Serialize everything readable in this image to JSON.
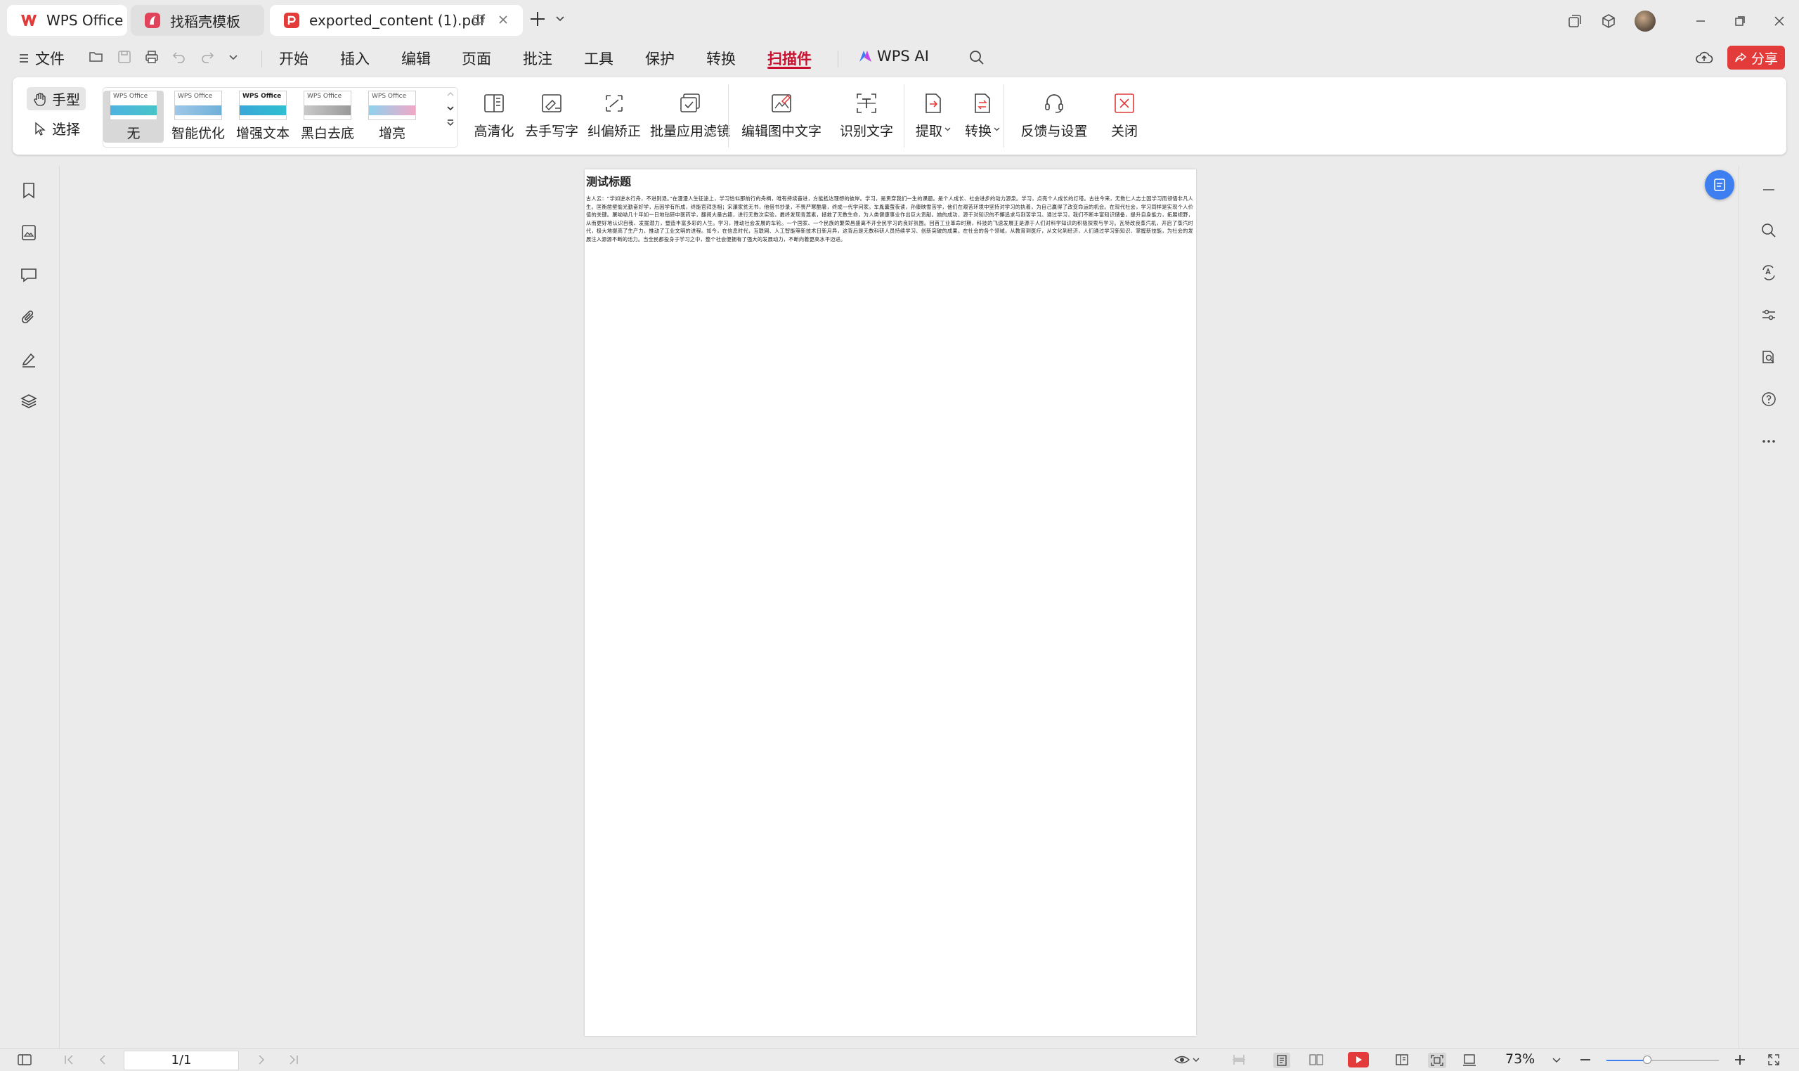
{
  "tabs": [
    {
      "label": "WPS Office",
      "icon": "wps-logo-icon"
    },
    {
      "label": "找稻壳模板",
      "icon": "docer-icon"
    },
    {
      "label": "exported_content (1).pdf",
      "icon": "pdf-icon"
    }
  ],
  "menu": {
    "file": "文件",
    "items": [
      "开始",
      "插入",
      "编辑",
      "页面",
      "批注",
      "工具",
      "保护",
      "转换",
      "扫描件"
    ],
    "active": "扫描件",
    "wps_ai": "WPS AI",
    "share": "分享"
  },
  "ribbon": {
    "hand": "手型",
    "select": "选择",
    "filter_thumb_text": "WPS Office",
    "filters": [
      "无",
      "智能优化",
      "增强文本",
      "黑白去底",
      "增亮"
    ],
    "tools": [
      "高清化",
      "去手写字",
      "纠偏矫正",
      "批量应用滤镜",
      "编辑图中文字",
      "识别文字",
      "提取",
      "转换",
      "反馈与设置",
      "关闭"
    ]
  },
  "document": {
    "title": "测试标题",
    "body": "古人云：“学如逆水行舟，不进则退。”在漫漫人生征途上，学习恰似那前行的舟楫，唯有持续奋进，方能抵达理想的彼岸。学习，是贯穿我们一生的课题。是个人成长、社会进步的动力源泉。学习，点亮个人成长的灯塔。古往今来，无数仁人志士因学习而领悟非凡人生。匡衡凿壁偷光勤奋好学，后因学有所成，终能官拜丞相；宋濂家贫无书，他借书抄录，不畏严寒酷暑，终成一代学问家。车胤囊萤夜读，孙康映雪苦学，他们在艰苦环境中坚持对学习的执着，为自己赢得了改变命运的机会。在现代社会，学习同样是实现个人价值的关键。屠呦呦几十年如一日地钻研中医药学，翻阅大量古籍，进行无数次实验，最终发现青蒿素，拯救了无数生命，为人类健康事业作出巨大贡献。她的成功，源于对知识的不懈追求与刻苦学习。通过学习，我们不断丰富知识储备，提升自身能力，拓展视野，从而更好地认识自我、发掘潜力，塑造丰富多彩的人生。学习，推动社会发展的车轮。一个国家、一个民族的繁荣昌盛离不开全民学习的良好氛围。回首工业革命时期，科技的飞速发展正是源于人们对科学知识的积极探索与学习。瓦特改良蒸汽机，开启了蒸汽时代，极大地提高了生产力，推动了工业文明的进程。如今，在信息时代，互联网、人工智能等新技术日新月异，这背后是无数科研人员持续学习、创新突破的成果。在社会的各个领域，从教育到医疗，从文化到经济，人们通过学习新知识、掌握新技能，为社会的发展注入源源不断的活力。当全民都投身于学习之中，整个社会便拥有了强大的发展动力，不断向着更高水平迈进。"
  },
  "statusbar": {
    "page": "1/1",
    "zoom": "73%",
    "zoom_level": 0.36
  },
  "colors": {
    "accent": "#c8102e",
    "share": "#e33a3a",
    "blue": "#3d7ff0"
  }
}
